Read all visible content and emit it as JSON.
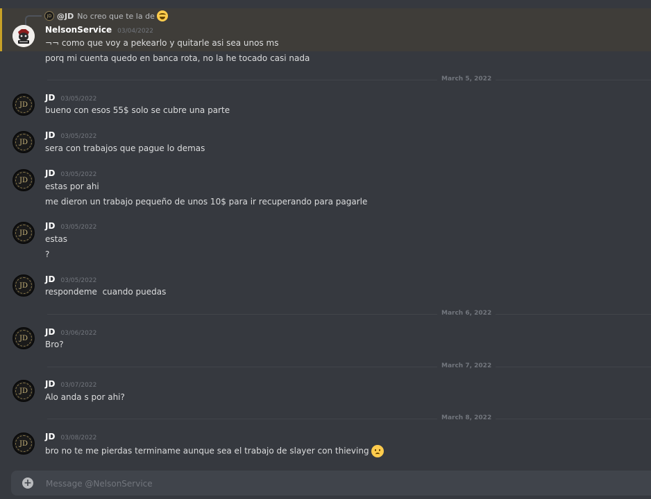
{
  "reply": {
    "author": "@JD",
    "snippet": "No creo que te la de",
    "avatar_initials": "JD"
  },
  "messages": [
    {
      "author": "NelsonService",
      "time": "03/04/2022",
      "lines": [
        "¬¬ como que voy a pekearlo y quitarle asi sea unos ms",
        "porq mi cuenta quedo en banca rota, no la he tocado casi nada"
      ]
    },
    {
      "author": "JD",
      "time": "03/05/2022",
      "lines": [
        "bueno con esos 55$ solo se cubre una parte"
      ]
    },
    {
      "author": "JD",
      "time": "03/05/2022",
      "lines": [
        "sera con trabajos que pague lo demas"
      ]
    },
    {
      "author": "JD",
      "time": "03/05/2022",
      "lines": [
        "estas por ahi",
        "me dieron un trabajo pequeño de unos 10$ para ir recuperando para pagarle"
      ]
    },
    {
      "author": "JD",
      "time": "03/05/2022",
      "lines": [
        "estas",
        "?"
      ]
    },
    {
      "author": "JD",
      "time": "03/05/2022",
      "lines": [
        "respondeme  cuando puedas"
      ]
    },
    {
      "author": "JD",
      "time": "03/06/2022",
      "lines": [
        "Bro?"
      ]
    },
    {
      "author": "JD",
      "time": "03/07/2022",
      "lines": [
        "Alo anda s por ahi?"
      ]
    },
    {
      "author": "JD",
      "time": "03/08/2022",
      "lines": [
        "bro no te me pierdas terminame aunque sea el trabajo de slayer con thieving"
      ]
    }
  ],
  "dividers": [
    "March 5, 2022",
    "March 6, 2022",
    "March 7, 2022",
    "March 8, 2022"
  ],
  "avatars": {
    "jd_initials": "JD"
  },
  "icons": {
    "reply_emoji": "laughing-tears-emoji",
    "last_emoji": "sad-face-emoji",
    "composer": "plus-circle-icon"
  },
  "colors": {
    "background": "#36393f",
    "highlight_bar": "#c9a227",
    "composer_bg": "#40444b",
    "timestamp": "#72767d"
  },
  "composer": {
    "placeholder": "Message @NelsonService"
  }
}
